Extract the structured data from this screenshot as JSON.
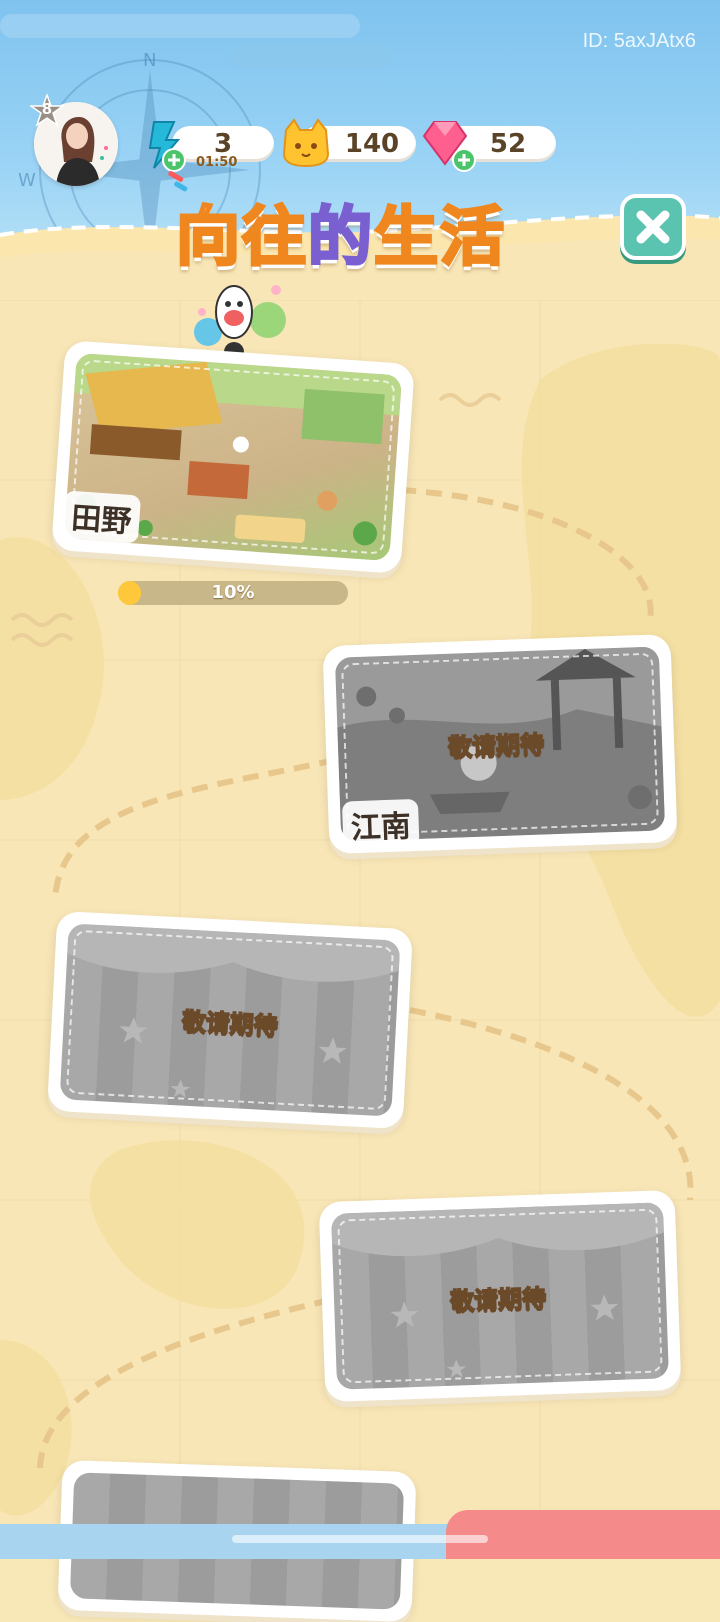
{
  "header": {
    "user_id": "ID: 5axJAtx6",
    "level": "8",
    "avatar_label": "avatar"
  },
  "resources": {
    "energy": {
      "value": "3",
      "timer": "01:50",
      "icon": "lightning-bolt-icon"
    },
    "coins": {
      "value": "140",
      "icon": "cat-coin-icon"
    },
    "gems": {
      "value": "52",
      "icon": "pink-gem-icon"
    }
  },
  "title": {
    "part1": "向往",
    "part2": "的",
    "part3": "生活"
  },
  "close_icon": "close-icon",
  "locations": [
    {
      "label": "田野",
      "status": "unlocked",
      "progress_percent": 10,
      "progress_text": "10%"
    },
    {
      "label": "江南",
      "status": "locked",
      "soon_text": "敬请期待"
    },
    {
      "label": "",
      "status": "locked",
      "soon_text": "敬请期待"
    },
    {
      "label": "",
      "status": "locked",
      "soon_text": "敬请期待"
    }
  ],
  "colors": {
    "sky": "#7fc3ef",
    "sand": "#f8e8b8",
    "title_fill": "#ffd24a",
    "title_stroke": "#f0871e",
    "close_button": "#5ac4b0",
    "progress_fill": "#ffc83a"
  }
}
